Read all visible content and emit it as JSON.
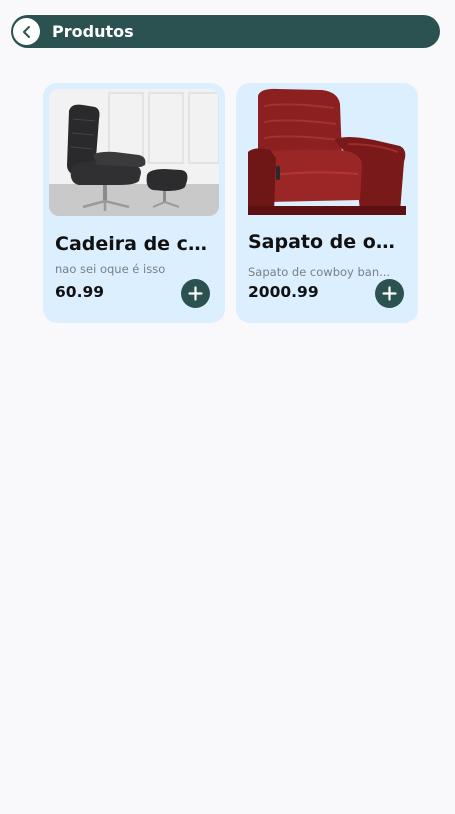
{
  "header": {
    "title": "Produtos",
    "back_icon": "chevron-left-icon"
  },
  "products": [
    {
      "name": "Cadeira de co...",
      "description": "nao sei oque é isso",
      "price": "60.99",
      "image": "black leather recliner chair with ottoman",
      "add_icon": "plus-icon"
    },
    {
      "name": "Sapato de ouro",
      "description": "Sapato de cowboy ban...",
      "price": "2000.99",
      "image": "red leather recliner armchair",
      "add_icon": "plus-icon"
    }
  ],
  "colors": {
    "primary": "#2b5150",
    "card_background": "#dcefff",
    "page_background": "#f9f9fb"
  }
}
